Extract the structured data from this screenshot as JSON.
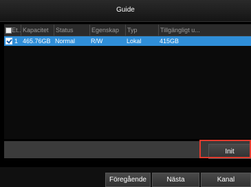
{
  "window": {
    "title": "Guide"
  },
  "table": {
    "columns": [
      "Et...",
      "Kapacitet",
      "Status",
      "Egenskap",
      "Typ",
      "Tillgängligt u..."
    ],
    "rows": [
      {
        "checked": true,
        "no": "1",
        "capacity": "465.76GB",
        "status": "Normal",
        "property": "R/W",
        "type": "Lokal",
        "free": "415GB"
      }
    ]
  },
  "buttons": {
    "init": "Init",
    "previous": "Föregående",
    "next": "Nästa",
    "channel": "Kanal"
  },
  "colors": {
    "selected_row": "#2f8ed8",
    "highlight": "#e23b2e"
  }
}
